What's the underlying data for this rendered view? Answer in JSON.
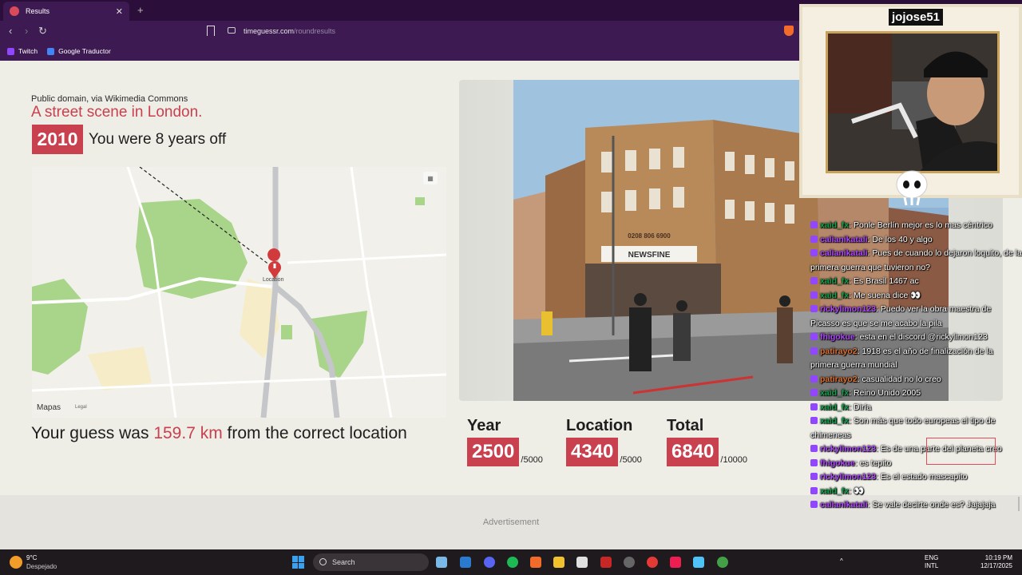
{
  "browser": {
    "tab_title": "Results",
    "tab_close": "✕",
    "new_tab": "+",
    "back": "‹",
    "forward": "›",
    "reload": "↻",
    "url_host": "timeguessr.com",
    "url_path": "/roundresults",
    "bookmarks": [
      {
        "label": "Twitch",
        "color": "#9146ff"
      },
      {
        "label": "Google Traductor",
        "color": "#4285f4"
      }
    ]
  },
  "result": {
    "credit": "Public domain, via Wikimedia Commons",
    "description": "A street scene in London.",
    "year": "2010",
    "years_off_text": "You were 8 years off",
    "map_marker_label": "Location",
    "map_brand": "Mapas",
    "map_legal": "Legal",
    "distance_prefix": "Your guess was ",
    "distance_value": "159.7 km",
    "distance_suffix": " from the correct location",
    "photo_sign_shop": "NEWSFINE",
    "photo_sign_phone": "0208 806 6900"
  },
  "scores": [
    {
      "label": "Year",
      "value": "2500",
      "max": "/5000"
    },
    {
      "label": "Location",
      "value": "4340",
      "max": "/5000"
    },
    {
      "label": "Total",
      "value": "6840",
      "max": "/10000"
    }
  ],
  "ad_label": "Advertisement",
  "stream": {
    "streamer_name": "jojose51"
  },
  "chat": [
    {
      "user": "xaid_fx",
      "color": "green",
      "text": "Ponle Berlín mejor es lo mas céntrico"
    },
    {
      "user": "calianikatali",
      "color": "purple",
      "text": "De los 40 y algo"
    },
    {
      "user": "calianikatali",
      "color": "purple",
      "text": "Pues de cuando lo dejaron loquito, de la primera guerra que tuvieron no?"
    },
    {
      "user": "xaid_fx",
      "color": "green",
      "text": "Es Brasil 1467 ac"
    },
    {
      "user": "xaid_fx",
      "color": "green",
      "text": "Me suena dice 👀"
    },
    {
      "user": "rickylimon123",
      "color": "purple",
      "text": "Puedo ver la obra maestra de Picasso es que se me acabo la pila"
    },
    {
      "user": "fhigokue",
      "color": "purple",
      "text": "esta en el discord @rickylimon123"
    },
    {
      "user": "patirayo2",
      "color": "orange",
      "text": "1918 es el año de finalización de la primera guerra mundial"
    },
    {
      "user": "patirayo2",
      "color": "orange",
      "text": "casualidad no lo creo"
    },
    {
      "user": "xaid_fx",
      "color": "green",
      "text": "Reino Unido 2005"
    },
    {
      "user": "xaid_fx",
      "color": "green",
      "text": "Diría"
    },
    {
      "user": "xaid_fx",
      "color": "green",
      "text": "Son más que todo europeas el tipo de chimeneas"
    },
    {
      "user": "rickylimon123",
      "color": "purple",
      "text": "Es de una parte del planeta creo"
    },
    {
      "user": "fhigokue",
      "color": "purple",
      "text": "es tepito"
    },
    {
      "user": "rickylimon123",
      "color": "purple",
      "text": "Es el estado mascapito"
    },
    {
      "user": "xaid_fx",
      "color": "green",
      "text": "👀"
    },
    {
      "user": "calianikatali",
      "color": "purple",
      "text": "Se vale decirte onde es? Jajajaja"
    }
  ],
  "taskbar": {
    "temperature": "9°C",
    "condition": "Despejado",
    "search_placeholder": "Search",
    "lang_top": "ENG",
    "lang_bottom": "INTL",
    "time": "10:19 PM",
    "date": "12/17/2025"
  },
  "colors": {
    "accent": "#c9404f",
    "chrome": "#3e1a52"
  }
}
